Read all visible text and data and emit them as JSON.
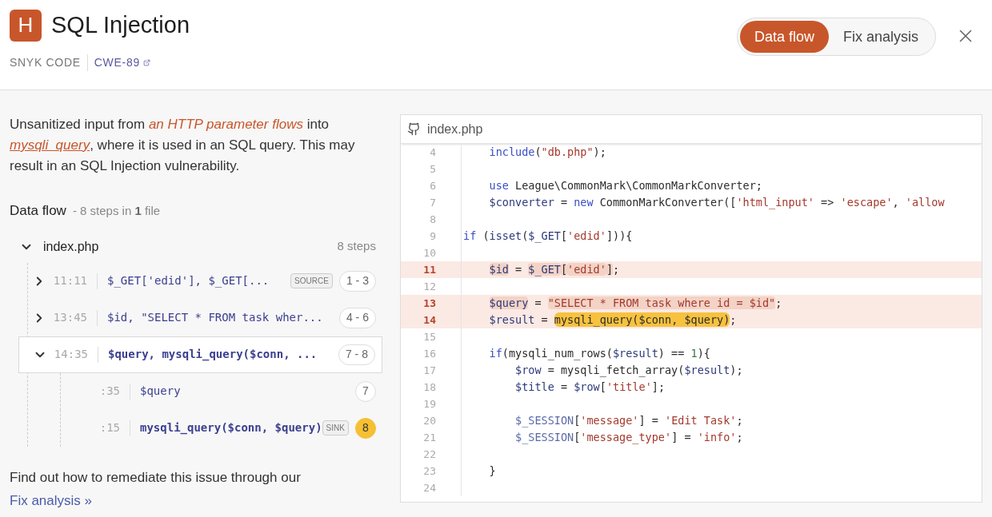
{
  "header": {
    "severity": "H",
    "title": "SQL Injection",
    "product": "SNYK CODE",
    "cwe": "CWE-89"
  },
  "tabs": [
    {
      "label": "Data flow",
      "selected": true
    },
    {
      "label": "Fix analysis",
      "selected": false
    }
  ],
  "description": "Unsanitized input from *an HTTP parameter flows* into ",
  "description_link": "mysqli_query",
  "description_rest": ", where it is used in an SQL query. This may result in an SQL Injection vulnerability.",
  "data_flow": {
    "title": "Data flow",
    "summary": "- 8 steps in **1** file",
    "file": {
      "name": "index.php",
      "expanded": true,
      "count": "8 steps"
    },
    "steps": [
      {
        "position": "11:11",
        "code": "$_GET['edid'], $_GET[...",
        "tag": "SOURCE",
        "range": "1 - 3",
        "expanded": false,
        "selected": false
      },
      {
        "position": "13:45",
        "code": "$id, \"SELECT * FROM task wher...",
        "range": "4 - 6",
        "expanded": false,
        "selected": false
      },
      {
        "position": "14:35",
        "code": "$query, mysqli_query($conn, ...",
        "range": "7 - 8",
        "expanded": true,
        "selected": false,
        "children": [
          {
            "position": ":35",
            "code": "$query",
            "range": "7",
            "selected": false
          },
          {
            "position": ":15",
            "code": "mysqli_query($conn, $query)",
            "tag": "SINK",
            "range": "8",
            "selected": true
          }
        ]
      }
    ]
  },
  "footer": {
    "text": "Find out how to remediate this issue through our",
    "link": "Fix analysis »"
  },
  "code_panel": {
    "file": "index.php",
    "lines": [
      {
        "n": "4",
        "marked": false,
        "tokens": [
          {
            "kind": "kw",
            "t": "    include"
          },
          {
            "kind": "p",
            "t": "("
          },
          {
            "kind": "str",
            "t": "\"db.php\""
          },
          {
            "kind": "p",
            "t": ");"
          }
        ]
      },
      {
        "n": "5",
        "marked": false
      },
      {
        "n": "6",
        "marked": false,
        "tokens": [
          {
            "kind": "kw",
            "t": "    use"
          },
          {
            "kind": "p",
            "t": " League\\CommonMark\\CommonMarkConverter;"
          }
        ]
      },
      {
        "n": "7",
        "marked": false,
        "tokens": [
          {
            "kind": "var",
            "t": "    $converter"
          },
          {
            "kind": "p",
            "t": " = "
          },
          {
            "kind": "kw",
            "t": "new"
          },
          {
            "kind": "p",
            "t": " CommonMarkConverter(["
          },
          {
            "kind": "str",
            "t": "'html_input'"
          },
          {
            "kind": "p",
            "t": " => "
          },
          {
            "kind": "str",
            "t": "'escape'"
          },
          {
            "kind": "p",
            "t": ", "
          },
          {
            "kind": "str",
            "t": "'allow"
          }
        ]
      },
      {
        "n": "8",
        "marked": false
      },
      {
        "n": "9",
        "marked": false,
        "tokens": [
          {
            "kind": "kw",
            "t": "if"
          },
          {
            "kind": "p",
            "t": " ("
          },
          {
            "kind": "var",
            "t": "isset"
          },
          {
            "kind": "p",
            "t": "("
          },
          {
            "kind": "var",
            "t": "$_GET"
          },
          {
            "kind": "p",
            "t": "["
          },
          {
            "kind": "str",
            "t": "'edid'"
          },
          {
            "kind": "p",
            "t": "])){"
          }
        ]
      },
      {
        "n": "10",
        "marked": false
      },
      {
        "n": "11",
        "marked": true,
        "tokens": [
          {
            "kind": "var",
            "t": "    $id",
            "source": true
          },
          {
            "kind": "p",
            "t": " = "
          },
          {
            "kind": "var",
            "t": "$_GET",
            "source": true
          },
          {
            "kind": "p",
            "t": "[",
            "source": true
          },
          {
            "kind": "str",
            "t": "'edid'",
            "source": true
          },
          {
            "kind": "p",
            "t": "]",
            "source": true
          },
          {
            "kind": "p",
            "t": ";"
          }
        ]
      },
      {
        "n": "12",
        "marked": false
      },
      {
        "n": "13",
        "marked": true,
        "tokens": [
          {
            "kind": "var",
            "t": "    $query",
            "source": true
          },
          {
            "kind": "p",
            "t": " = "
          },
          {
            "kind": "str",
            "t": "\"SELECT * FROM task where id = $id\"",
            "source": true
          },
          {
            "kind": "p",
            "t": ";"
          }
        ]
      },
      {
        "n": "14",
        "marked": true,
        "tokens": [
          {
            "kind": "var",
            "t": "    $result"
          },
          {
            "kind": "p",
            "t": " = "
          },
          {
            "kind": "p",
            "t": "mysqli_query($conn, $query)",
            "sink": true
          },
          {
            "kind": "p",
            "t": ";"
          }
        ]
      },
      {
        "n": "15",
        "marked": false
      },
      {
        "n": "16",
        "marked": false,
        "tokens": [
          {
            "kind": "kw",
            "t": "    if"
          },
          {
            "kind": "p",
            "t": "(mysqli_num_rows("
          },
          {
            "kind": "var",
            "t": "$result"
          },
          {
            "kind": "p",
            "t": ") == "
          },
          {
            "kind": "num",
            "t": "1"
          },
          {
            "kind": "p",
            "t": "){"
          }
        ]
      },
      {
        "n": "17",
        "marked": false,
        "tokens": [
          {
            "kind": "var",
            "t": "        $row"
          },
          {
            "kind": "p",
            "t": " = mysqli_fetch_array("
          },
          {
            "kind": "var",
            "t": "$result"
          },
          {
            "kind": "p",
            "t": ");"
          }
        ]
      },
      {
        "n": "18",
        "marked": false,
        "tokens": [
          {
            "kind": "var",
            "t": "        $title"
          },
          {
            "kind": "p",
            "t": " = "
          },
          {
            "kind": "var",
            "t": "$row"
          },
          {
            "kind": "p",
            "t": "["
          },
          {
            "kind": "str",
            "t": "'title'"
          },
          {
            "kind": "p",
            "t": "];"
          }
        ]
      },
      {
        "n": "19",
        "marked": false
      },
      {
        "n": "20",
        "marked": false,
        "tokens": [
          {
            "kind": "glob",
            "t": "        $_SESSION"
          },
          {
            "kind": "p",
            "t": "["
          },
          {
            "kind": "str",
            "t": "'message'"
          },
          {
            "kind": "p",
            "t": "] = "
          },
          {
            "kind": "str",
            "t": "'Edit Task'"
          },
          {
            "kind": "p",
            "t": ";"
          }
        ]
      },
      {
        "n": "21",
        "marked": false,
        "tokens": [
          {
            "kind": "glob",
            "t": "        $_SESSION"
          },
          {
            "kind": "p",
            "t": "["
          },
          {
            "kind": "str",
            "t": "'message_type'"
          },
          {
            "kind": "p",
            "t": "] = "
          },
          {
            "kind": "str",
            "t": "'info'"
          },
          {
            "kind": "p",
            "t": ";"
          }
        ]
      },
      {
        "n": "22",
        "marked": false
      },
      {
        "n": "23",
        "marked": false,
        "tokens": [
          {
            "kind": "p",
            "t": "    }"
          }
        ]
      },
      {
        "n": "24",
        "marked": false
      }
    ]
  }
}
